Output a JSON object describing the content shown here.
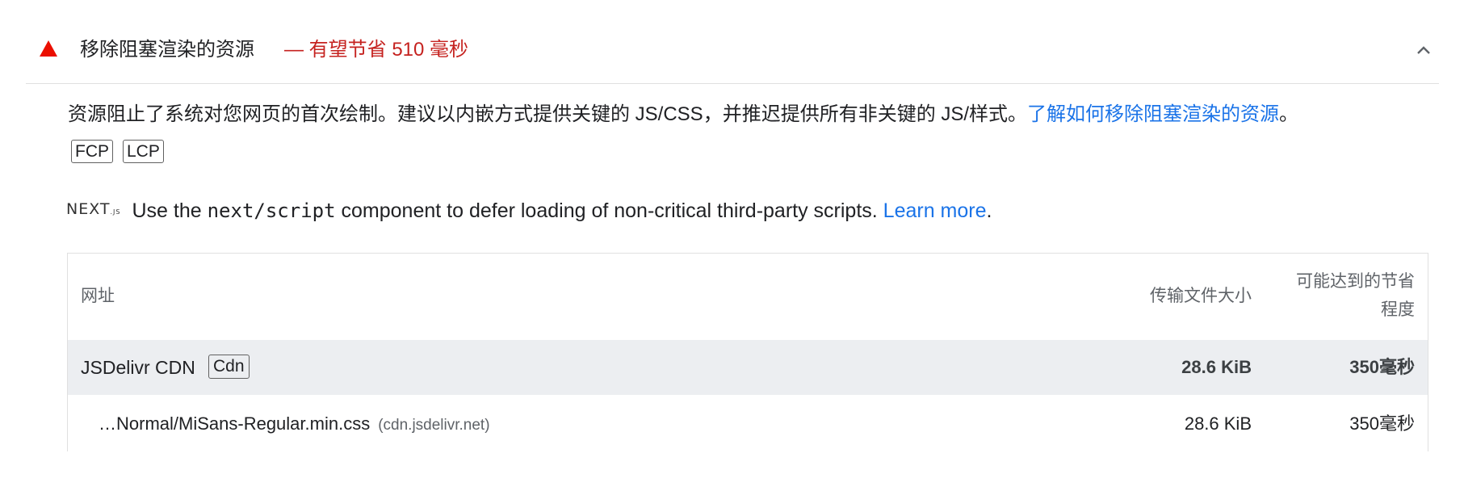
{
  "audit": {
    "title": "移除阻塞渲染的资源",
    "savings": "— 有望节省 510 毫秒",
    "status_color": "#eb0f00",
    "description_text": "资源阻止了系统对您网页的首次绘制。建议以内嵌方式提供关键的 JS/CSS，并推迟提供所有非关键的 JS/样式。",
    "description_link": "了解如何移除阻塞渲染的资源",
    "description_end": "。",
    "tags": [
      "FCP",
      "LCP"
    ]
  },
  "stack_pack": {
    "logo_text": "NEXT",
    "logo_suffix": ".JS",
    "text_before": "Use the ",
    "code": "next/script",
    "text_after": " component to defer loading of non-critical third-party scripts. ",
    "link": "Learn more",
    "end": "."
  },
  "table": {
    "headers": {
      "url": "网址",
      "size": "传输文件大小",
      "savings_line1": "可能达到的节省",
      "savings_line2": "程度"
    },
    "group": {
      "entity": "JSDelivr CDN",
      "tag": "Cdn",
      "size": "28.6 KiB",
      "savings": "350毫秒"
    },
    "rows": [
      {
        "url": "…Normal/MiSans-Regular.min.css",
        "host": "(cdn.jsdelivr.net)",
        "size": "28.6 KiB",
        "savings": "350毫秒"
      }
    ]
  }
}
